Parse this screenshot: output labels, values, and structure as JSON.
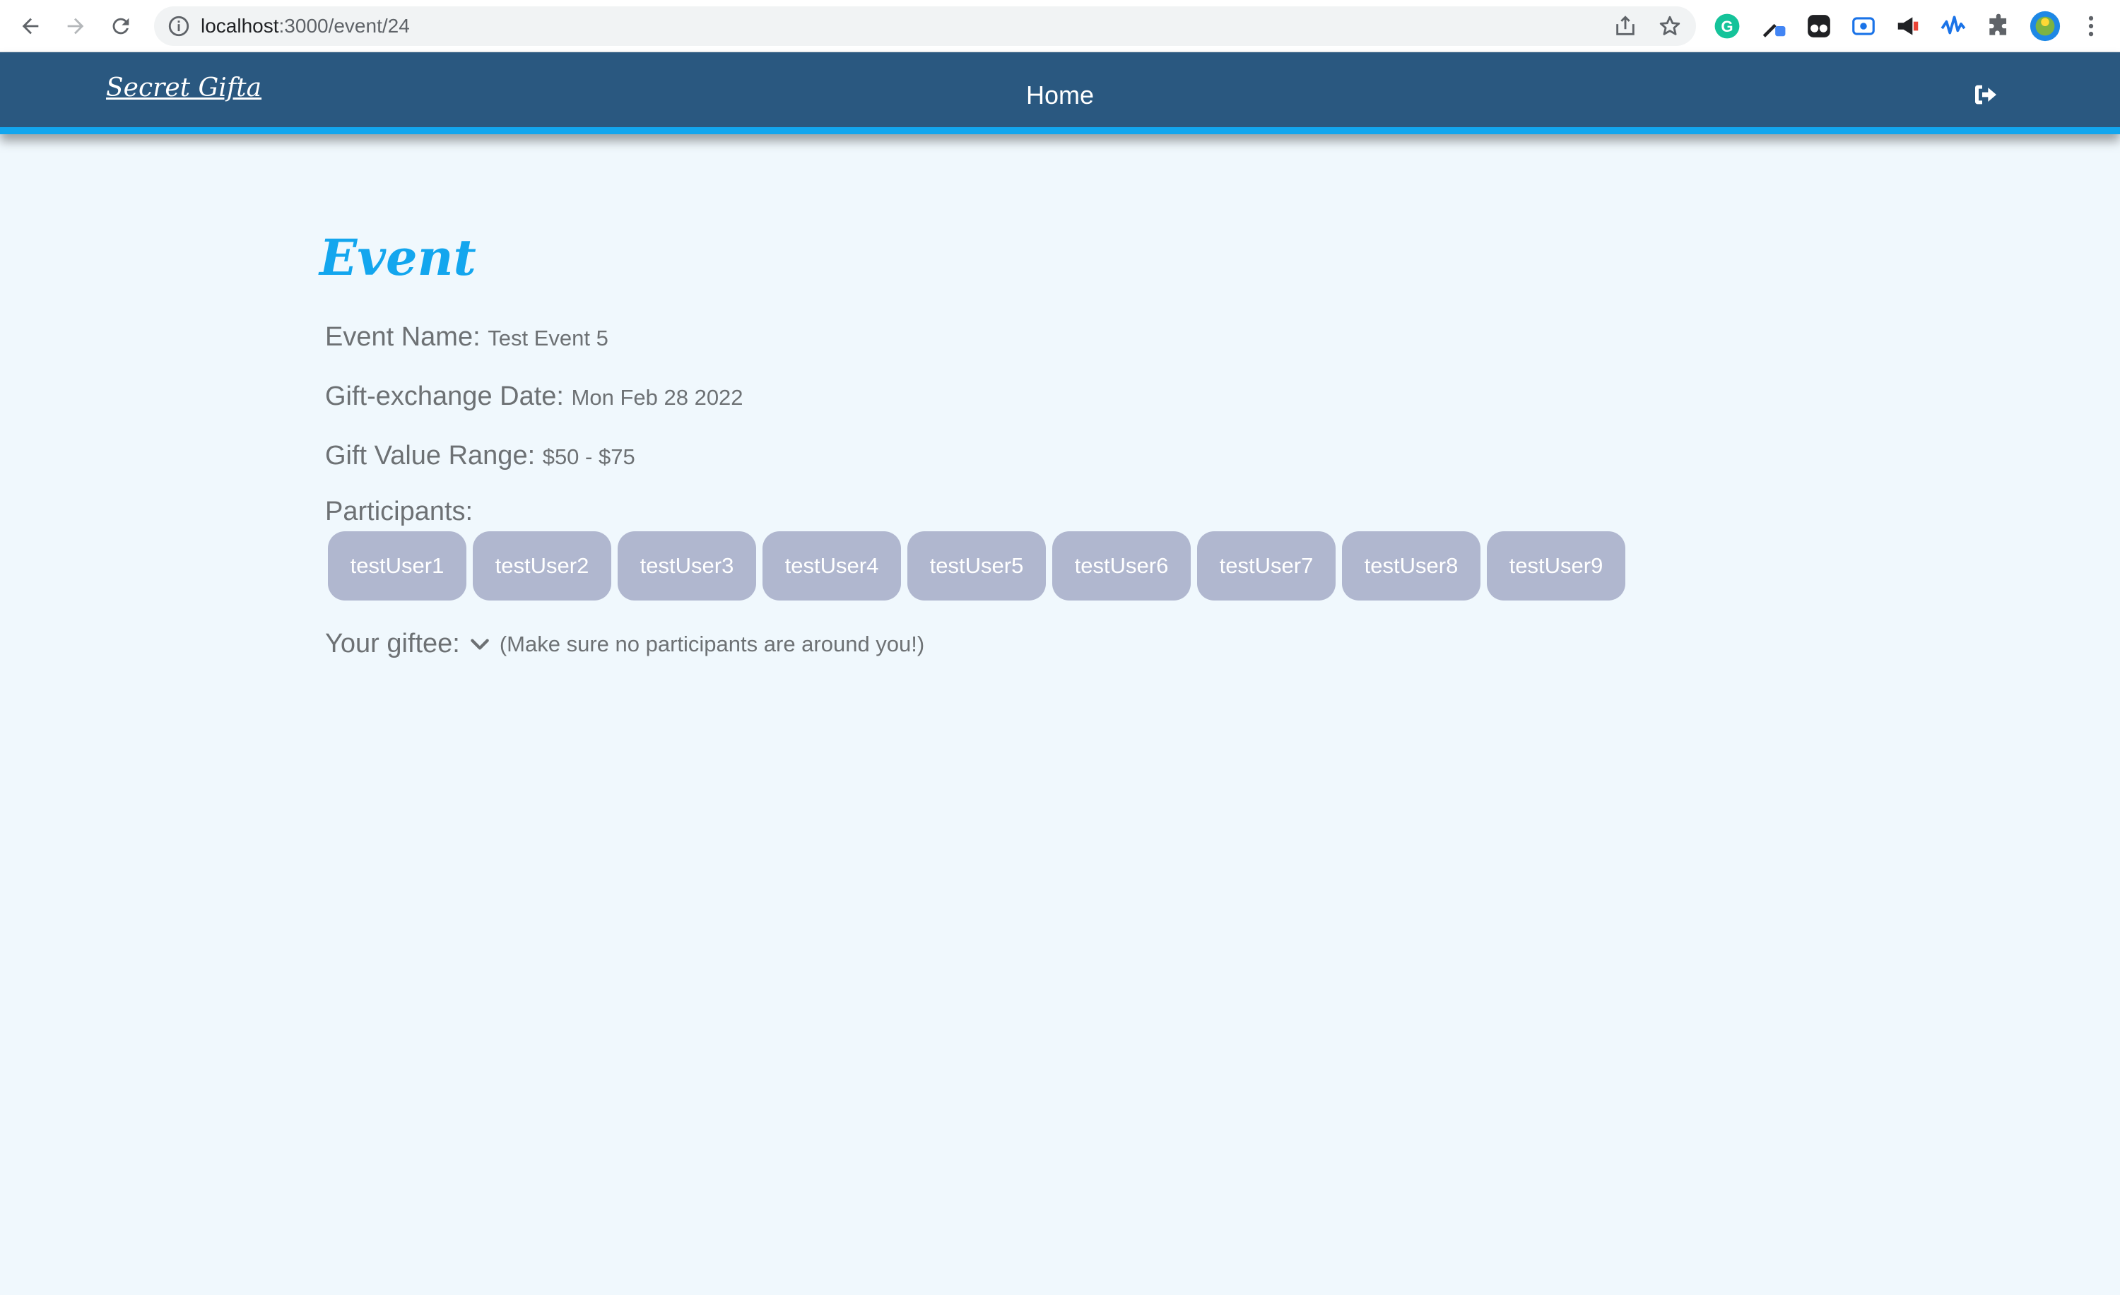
{
  "browser": {
    "url_host": "localhost",
    "url_path": ":3000/event/24",
    "extensions": [
      "grammarly-icon",
      "eyedropper-icon",
      "tampermonkey-icon",
      "screencast-icon",
      "megaphone-icon",
      "waveform-icon",
      "puzzle-icon",
      "profile-avatar"
    ]
  },
  "navbar": {
    "brand": "Secret Gifta",
    "home_label": "Home",
    "logout_icon": "sign-out-icon"
  },
  "event": {
    "title": "Event",
    "name_label": "Event Name:",
    "name_value": "Test Event 5",
    "date_label": "Gift-exchange Date:",
    "date_value": "Mon Feb 28 2022",
    "range_label": "Gift Value Range:",
    "range_value": "$50 - $75",
    "participants_label": "Participants:",
    "participants": [
      "testUser1",
      "testUser2",
      "testUser3",
      "testUser4",
      "testUser5",
      "testUser6",
      "testUser7",
      "testUser8",
      "testUser9"
    ],
    "giftee_label": "Your giftee:",
    "giftee_hint": "(Make sure no participants are around you!)"
  },
  "colors": {
    "navbar_bg": "#2a5880",
    "accent": "#13a6ee",
    "page_bg": "#f0f8fd",
    "chip_bg": "#b0b7cf",
    "text_muted": "#6d7174"
  }
}
